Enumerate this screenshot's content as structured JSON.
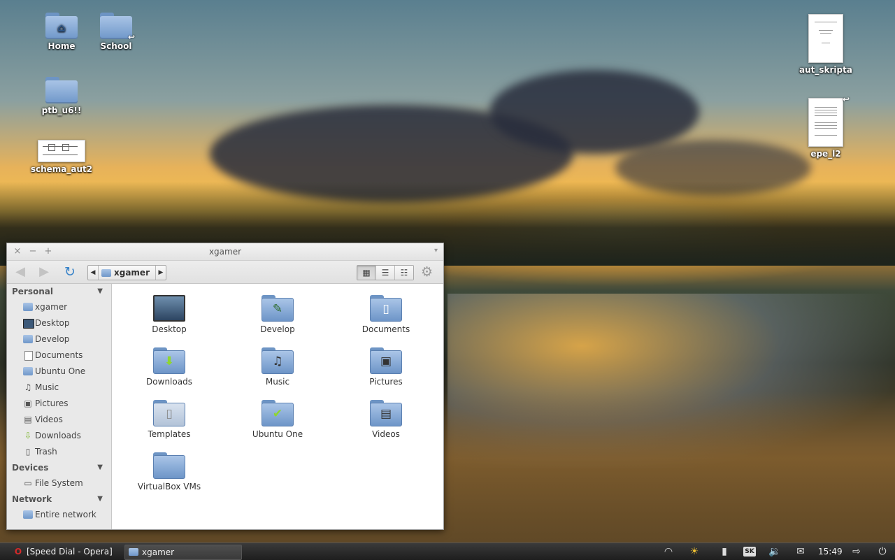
{
  "desktop": {
    "icons": [
      {
        "label": "Home"
      },
      {
        "label": "School"
      },
      {
        "label": "ptb_u6!!"
      },
      {
        "label": "schema_aut2"
      },
      {
        "label": "aut_skripta"
      },
      {
        "label": "epe_l2"
      }
    ]
  },
  "window": {
    "title": "xgamer",
    "controls": {
      "close": "×",
      "minimize": "−",
      "maximize": "+",
      "menu": "▾"
    },
    "toolbar": {
      "back": "◀",
      "forward": "▶",
      "refresh": "↻",
      "path_left": "◀",
      "path_right": "▶",
      "crumb": "xgamer",
      "views": [
        "▦",
        "☰",
        "☷"
      ],
      "settings": "⚙"
    },
    "sidebar": {
      "sections": [
        {
          "title": "Personal",
          "items": [
            {
              "label": "xgamer",
              "icon": "home-folder-icon"
            },
            {
              "label": "Desktop",
              "icon": "desktop-icon"
            },
            {
              "label": "Develop",
              "icon": "folder-icon"
            },
            {
              "label": "Documents",
              "icon": "document-icon"
            },
            {
              "label": "Ubuntu One",
              "icon": "folder-icon"
            },
            {
              "label": "Music",
              "icon": "music-icon"
            },
            {
              "label": "Pictures",
              "icon": "pictures-icon"
            },
            {
              "label": "Videos",
              "icon": "videos-icon"
            },
            {
              "label": "Downloads",
              "icon": "downloads-icon"
            },
            {
              "label": "Trash",
              "icon": "trash-icon"
            }
          ]
        },
        {
          "title": "Devices",
          "items": [
            {
              "label": "File System",
              "icon": "drive-icon"
            }
          ]
        },
        {
          "title": "Network",
          "items": [
            {
              "label": "Entire network",
              "icon": "network-icon"
            }
          ]
        }
      ]
    },
    "files": [
      {
        "label": "Desktop",
        "icon": "desktop-icon"
      },
      {
        "label": "Develop",
        "icon": "develop-folder-icon"
      },
      {
        "label": "Documents",
        "icon": "documents-folder-icon"
      },
      {
        "label": "Downloads",
        "icon": "downloads-folder-icon"
      },
      {
        "label": "Music",
        "icon": "music-folder-icon"
      },
      {
        "label": "Pictures",
        "icon": "pictures-folder-icon"
      },
      {
        "label": "Templates",
        "icon": "templates-folder-icon"
      },
      {
        "label": "Ubuntu One",
        "icon": "ubuntu-one-folder-icon"
      },
      {
        "label": "Videos",
        "icon": "videos-folder-icon"
      },
      {
        "label": "VirtualBox VMs",
        "icon": "folder-icon"
      }
    ]
  },
  "taskbar": {
    "tasks": [
      {
        "label": "[Speed Dial - Opera]",
        "icon": "opera-icon"
      },
      {
        "label": "xgamer",
        "icon": "file-manager-icon"
      }
    ],
    "tray": {
      "keyboard_layout": "SK",
      "clock": "15:49"
    }
  },
  "colors": {
    "accent": "#3a84c9",
    "folder": "#6f97c9",
    "taskbar": "#1e1e1e"
  }
}
